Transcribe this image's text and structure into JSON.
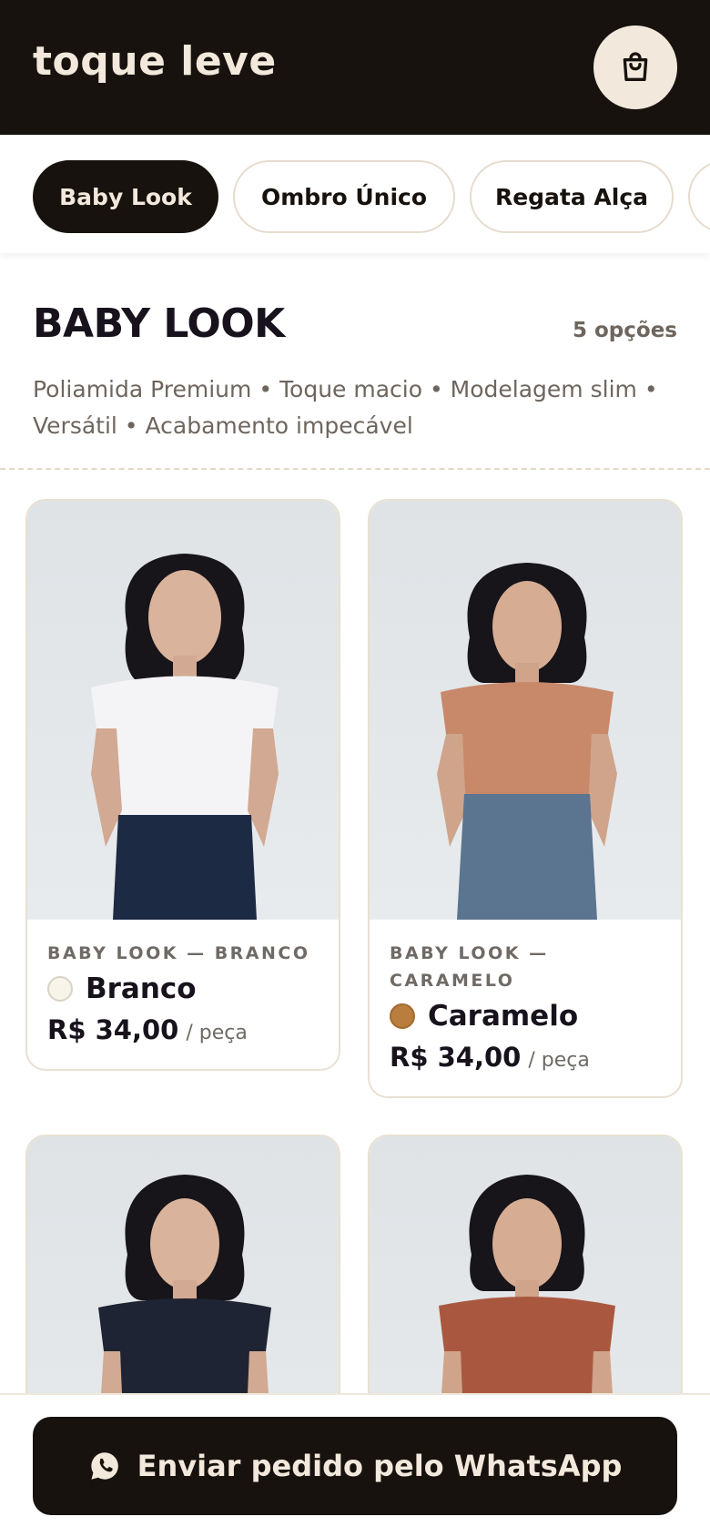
{
  "header": {
    "brand": "toque leve",
    "cart_icon": "shopping-bag-icon"
  },
  "tabs": [
    {
      "label": "Baby Look",
      "active": true
    },
    {
      "label": "Ombro Único",
      "active": false
    },
    {
      "label": "Regata Alça",
      "active": false
    }
  ],
  "section": {
    "title": "BABY LOOK",
    "count": "5 opções",
    "description": "Poliamida Premium • Toque macio • Modelagem slim • Versátil • Acabamento impecável"
  },
  "products": [
    {
      "subtitle": "BABY LOOK — BRANCO",
      "name": "Branco",
      "swatch_color": "#f7f4ea",
      "shirt_color": "#f4f4f6",
      "price": "R$ 34,00",
      "unit": "/ peça"
    },
    {
      "subtitle": "BABY LOOK — CARAMELO",
      "name": "Caramelo",
      "swatch_color": "#b97d3e",
      "shirt_color": "#c8886a",
      "price": "R$ 34,00",
      "unit": "/ peça"
    },
    {
      "shirt_color": "#1e2433"
    },
    {
      "shirt_color": "#a9583f"
    }
  ],
  "footer": {
    "button_label": "Enviar pedido pelo WhatsApp",
    "icon": "whatsapp-icon"
  },
  "colors": {
    "dark": "#17120d",
    "cream": "#f3e8dc",
    "muted": "#6e665e",
    "border": "#e8e0d2"
  }
}
